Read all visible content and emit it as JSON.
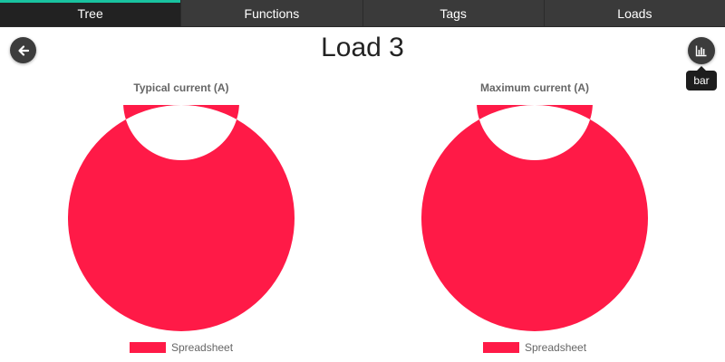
{
  "tabs": [
    {
      "label": "Tree",
      "active": true
    },
    {
      "label": "Functions",
      "active": false
    },
    {
      "label": "Tags",
      "active": false
    },
    {
      "label": "Loads",
      "active": false
    }
  ],
  "page": {
    "title": "Load 3",
    "back_icon": "arrow-left-icon",
    "chart_toggle_icon": "bar-chart-icon",
    "chart_toggle_tooltip": "bar"
  },
  "colors": {
    "accent": "#19c3a0",
    "series": "#ff1a47",
    "tabbar": "#3a3a3a",
    "button": "#3c3c3c"
  },
  "chart_data": [
    {
      "type": "pie",
      "title": "Typical current (A)",
      "labels": [
        "Spreadsheet"
      ],
      "values": [
        1
      ],
      "colors": [
        "#ff1a47"
      ],
      "legend": "bottom"
    },
    {
      "type": "pie",
      "title": "Maximum current (A)",
      "labels": [
        "Spreadsheet"
      ],
      "values": [
        1
      ],
      "colors": [
        "#ff1a47"
      ],
      "legend": "bottom"
    }
  ]
}
